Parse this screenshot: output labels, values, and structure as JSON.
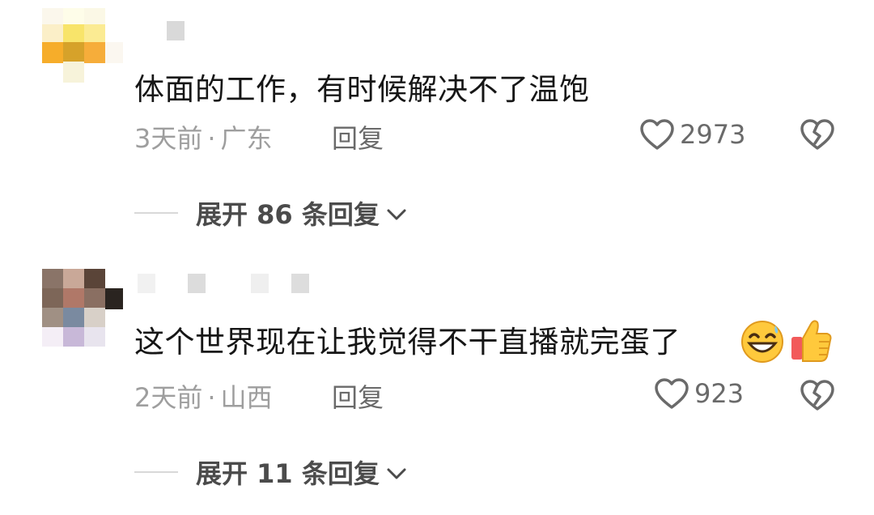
{
  "comments": [
    {
      "text": "体面的工作，有时候解决不了温饱",
      "time": "3天前",
      "location": "广东",
      "reply_label": "回复",
      "likes": "2973",
      "expand_label": "展开 86 条回复"
    },
    {
      "text": "这个世界现在让我觉得不干直播就完蛋了",
      "emojis": [
        "grinning-sweat-emoji",
        "thumbs-up-emoji"
      ],
      "time": "2天前",
      "location": "山西",
      "reply_label": "回复",
      "likes": "923",
      "expand_label": "展开 11 条回复"
    }
  ],
  "colors": {
    "text": "#161616",
    "meta": "#9e9e9e",
    "action": "#6a6a6a"
  },
  "icons": [
    "heart-outline-icon",
    "broken-heart-icon",
    "chevron-down-icon"
  ]
}
